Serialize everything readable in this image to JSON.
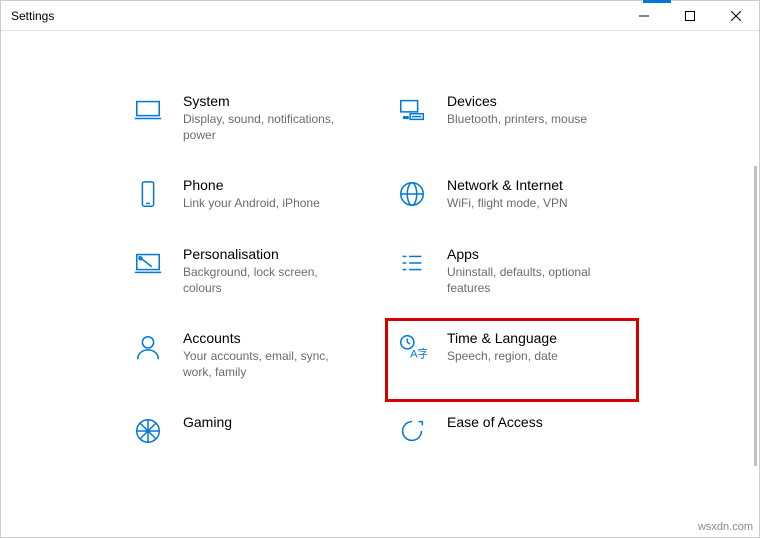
{
  "window": {
    "title": "Settings"
  },
  "categories": [
    {
      "key": "system",
      "title": "System",
      "desc": "Display, sound, notifications, power"
    },
    {
      "key": "devices",
      "title": "Devices",
      "desc": "Bluetooth, printers, mouse"
    },
    {
      "key": "phone",
      "title": "Phone",
      "desc": "Link your Android, iPhone"
    },
    {
      "key": "network",
      "title": "Network & Internet",
      "desc": "WiFi, flight mode, VPN"
    },
    {
      "key": "personalisation",
      "title": "Personalisation",
      "desc": "Background, lock screen, colours"
    },
    {
      "key": "apps",
      "title": "Apps",
      "desc": "Uninstall, defaults, optional features"
    },
    {
      "key": "accounts",
      "title": "Accounts",
      "desc": "Your accounts, email, sync, work, family"
    },
    {
      "key": "time-language",
      "title": "Time & Language",
      "desc": "Speech, region, date",
      "highlight": true
    },
    {
      "key": "gaming",
      "title": "Gaming",
      "desc": ""
    },
    {
      "key": "ease-of-access",
      "title": "Ease of Access",
      "desc": ""
    }
  ],
  "watermark": "wsxdn.com"
}
